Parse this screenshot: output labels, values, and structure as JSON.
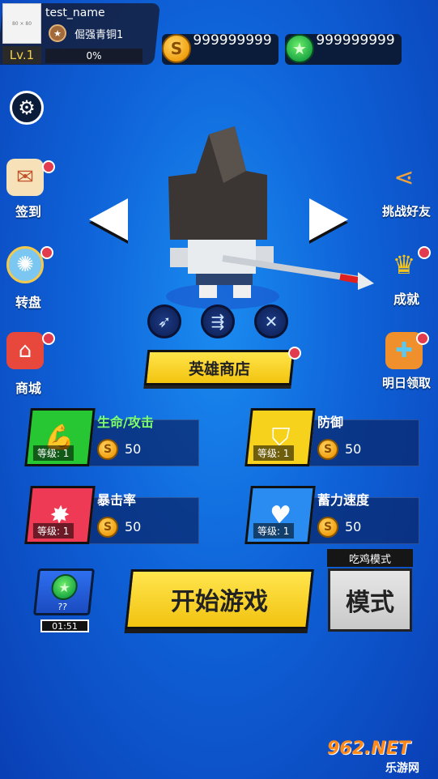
{
  "profile": {
    "avatar_text": "80 × 80",
    "level": "Lv.1",
    "name": "test_name",
    "rank": "倔强青铜1",
    "exp": "0%"
  },
  "currency": {
    "coins": "999999999",
    "gems": "999999999"
  },
  "side_left": {
    "checkin": "签到",
    "wheel": "转盘",
    "shop": "商城"
  },
  "side_right": {
    "challenge": "挑战好友",
    "achievement": "成就",
    "tomorrow": "明日领取"
  },
  "hero": {
    "shop_button": "英雄商店",
    "skills": [
      "skill-arrow-single",
      "skill-arrow-triple",
      "skill-arrow-cross"
    ]
  },
  "upgrades": [
    {
      "title": "生命/攻击",
      "level": "等级: 1",
      "cost": "50"
    },
    {
      "title": "防御",
      "level": "等级: 1",
      "cost": "50"
    },
    {
      "title": "暴击率",
      "level": "等级: 1",
      "cost": "50"
    },
    {
      "title": "蓄力速度",
      "level": "等级: 1",
      "cost": "50"
    }
  ],
  "bottom": {
    "chest_label": "??",
    "timer": "01:51",
    "start": "开始游戏",
    "mode_tag": "吃鸡模式",
    "mode": "模式"
  },
  "watermark": {
    "brand": "962.NET",
    "sub": "乐游网"
  },
  "colors": {
    "accent_yellow": "#f7d21c",
    "bg_blue": "#1a7ae8",
    "health_green": "#2ad334",
    "defense_yellow": "#f7d21c",
    "crit_red": "#ef3a55",
    "charge_blue": "#2a8cf0",
    "dot_red": "#e23b4d"
  }
}
